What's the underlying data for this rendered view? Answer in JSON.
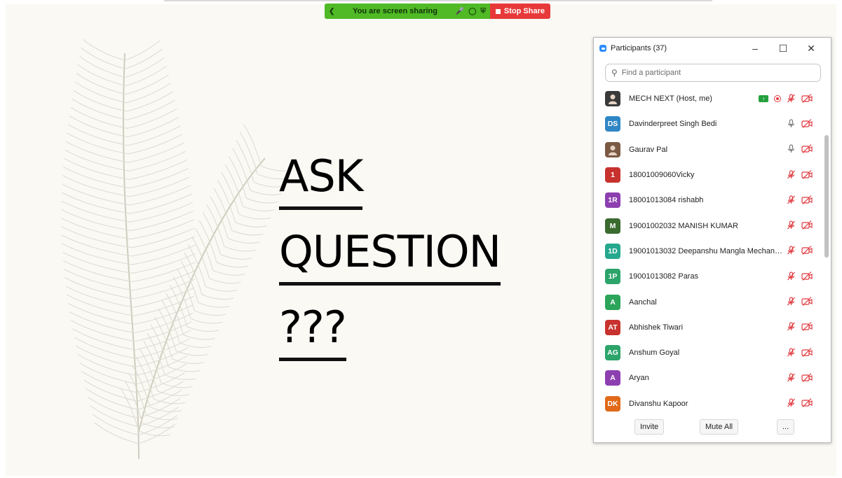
{
  "share_bar": {
    "message": "You are screen sharing",
    "stop_label": "Stop Share",
    "colors": {
      "bar": "#4fba25",
      "stop": "#e8393a"
    }
  },
  "slide": {
    "lines": [
      "ASK",
      "QUESTION",
      "???"
    ]
  },
  "panel": {
    "title": "Participants (37)",
    "search_placeholder": "Find a participant",
    "participants": [
      {
        "name": "MECH NEXT (Host, me)",
        "initials": "",
        "avatar_color": "#3a3a3a",
        "mic": "off",
        "sharing": true,
        "recording": true
      },
      {
        "name": "Davinderpreet Singh Bedi",
        "initials": "DS",
        "avatar_color": "#2f86c4",
        "mic": "on"
      },
      {
        "name": "Gaurav Pal",
        "initials": "",
        "avatar_color": "#7b5a44",
        "mic": "on"
      },
      {
        "name": "18001009060Vicky",
        "initials": "1",
        "avatar_color": "#c8322e",
        "mic": "off"
      },
      {
        "name": "18001013084 rishabh",
        "initials": "1R",
        "avatar_color": "#8d3fb0",
        "mic": "off"
      },
      {
        "name": "19001002032 MANISH KUMAR",
        "initials": "M",
        "avatar_color": "#3a6b2f",
        "mic": "off"
      },
      {
        "name": "19001013032 Deepanshu Mangla Mechani...",
        "initials": "1D",
        "avatar_color": "#25a88e",
        "mic": "off"
      },
      {
        "name": "19001013082 Paras",
        "initials": "1P",
        "avatar_color": "#2ca46a",
        "mic": "off"
      },
      {
        "name": "Aanchal",
        "initials": "A",
        "avatar_color": "#2ca45a",
        "mic": "off"
      },
      {
        "name": "Abhishek Tiwari",
        "initials": "AT",
        "avatar_color": "#c8322e",
        "mic": "off"
      },
      {
        "name": "Anshum Goyal",
        "initials": "AG",
        "avatar_color": "#2ca46a",
        "mic": "off"
      },
      {
        "name": "Aryan",
        "initials": "A",
        "avatar_color": "#8d3fb0",
        "mic": "off"
      },
      {
        "name": "Divanshu Kapoor",
        "initials": "DK",
        "avatar_color": "#e06a1a",
        "mic": "off"
      }
    ],
    "invite_label": "Invite",
    "mute_all_label": "Mute All",
    "more_label": "..."
  }
}
